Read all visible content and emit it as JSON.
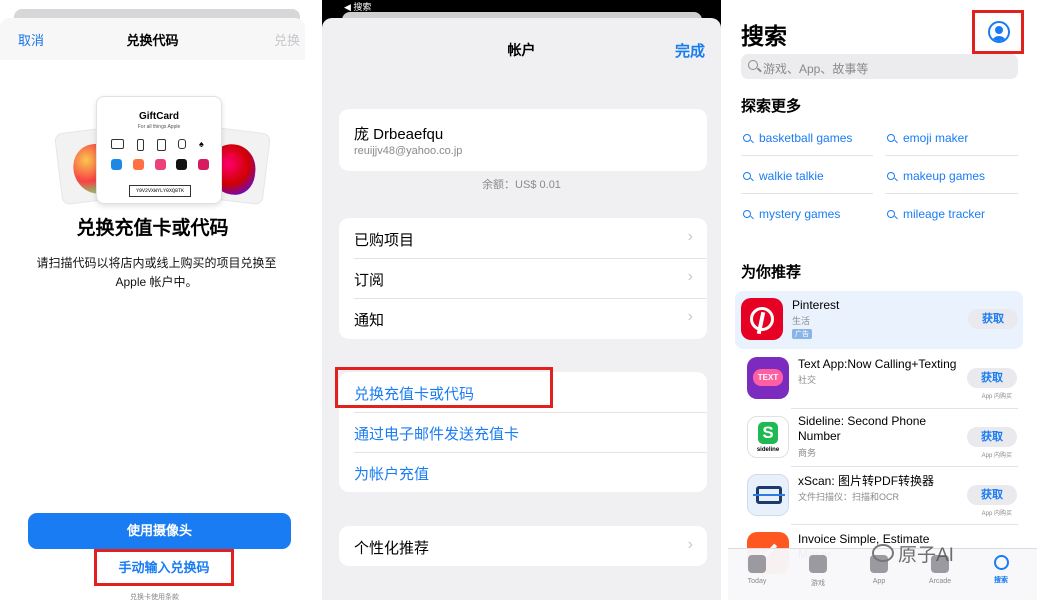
{
  "panel1": {
    "header": {
      "cancel": "取消",
      "title": "兑换代码",
      "redeem": "兑换"
    },
    "gift_card": {
      "brand": "GiftCard",
      "subtitle": "For all things Apple",
      "code": "Y9V2VXWYLY0XQ8TK"
    },
    "heading": "兑换充值卡或代码",
    "description": "请扫描代码以将店内或线上购买的项目兑换至 Apple 帐户中。",
    "camera_button": "使用摄像头",
    "manual_button": "手动输入兑换码",
    "footer_partial": "兑换卡使用条款"
  },
  "panel2": {
    "status_back": "◀ 搜索",
    "title": "帐户",
    "done": "完成",
    "account": {
      "name": "庞 Drbeaefqu",
      "email": "reuijjv48@yahoo.co.jp",
      "balance": "余额：US$ 0.01"
    },
    "menu": [
      {
        "label": "已购项目"
      },
      {
        "label": "订阅"
      },
      {
        "label": "通知"
      }
    ],
    "actions": [
      {
        "label": "兑换充值卡或代码"
      },
      {
        "label": "通过电子邮件发送充值卡"
      },
      {
        "label": "为帐户充值"
      }
    ],
    "personalized": "个性化推荐"
  },
  "panel3": {
    "title": "搜索",
    "search_placeholder": "游戏、App、故事等",
    "discover_title": "探索更多",
    "suggestions": [
      "basketball games",
      "emoji maker",
      "walkie talkie",
      "makeup games",
      "mystery games",
      "mileage tracker"
    ],
    "recommend_title": "为你推荐",
    "apps": [
      {
        "name": "Pinterest",
        "category": "生活",
        "tag": "广告",
        "get": "获取",
        "note": ""
      },
      {
        "name": "Text App:Now Calling+Texting",
        "category": "社交",
        "tag": "",
        "get": "获取",
        "note": "App 内购买"
      },
      {
        "name": "Sideline: Second Phone Number",
        "category": "商务",
        "tag": "",
        "get": "获取",
        "note": "App 内购买"
      },
      {
        "name": "xScan: 图片转PDF转换器",
        "category": "文件扫描仪：扫描和OCR",
        "tag": "",
        "get": "获取",
        "note": "App 内购买"
      },
      {
        "name": "Invoice Simple, Estimate Maker",
        "category": "",
        "tag": "",
        "get": "获取",
        "note": ""
      }
    ],
    "tabs": [
      "Today",
      "游戏",
      "App",
      "Arcade",
      "搜索"
    ],
    "watermark": "原子AI"
  },
  "colors": {
    "accent": "#1a7cf2",
    "highlight": "#e0211d"
  }
}
